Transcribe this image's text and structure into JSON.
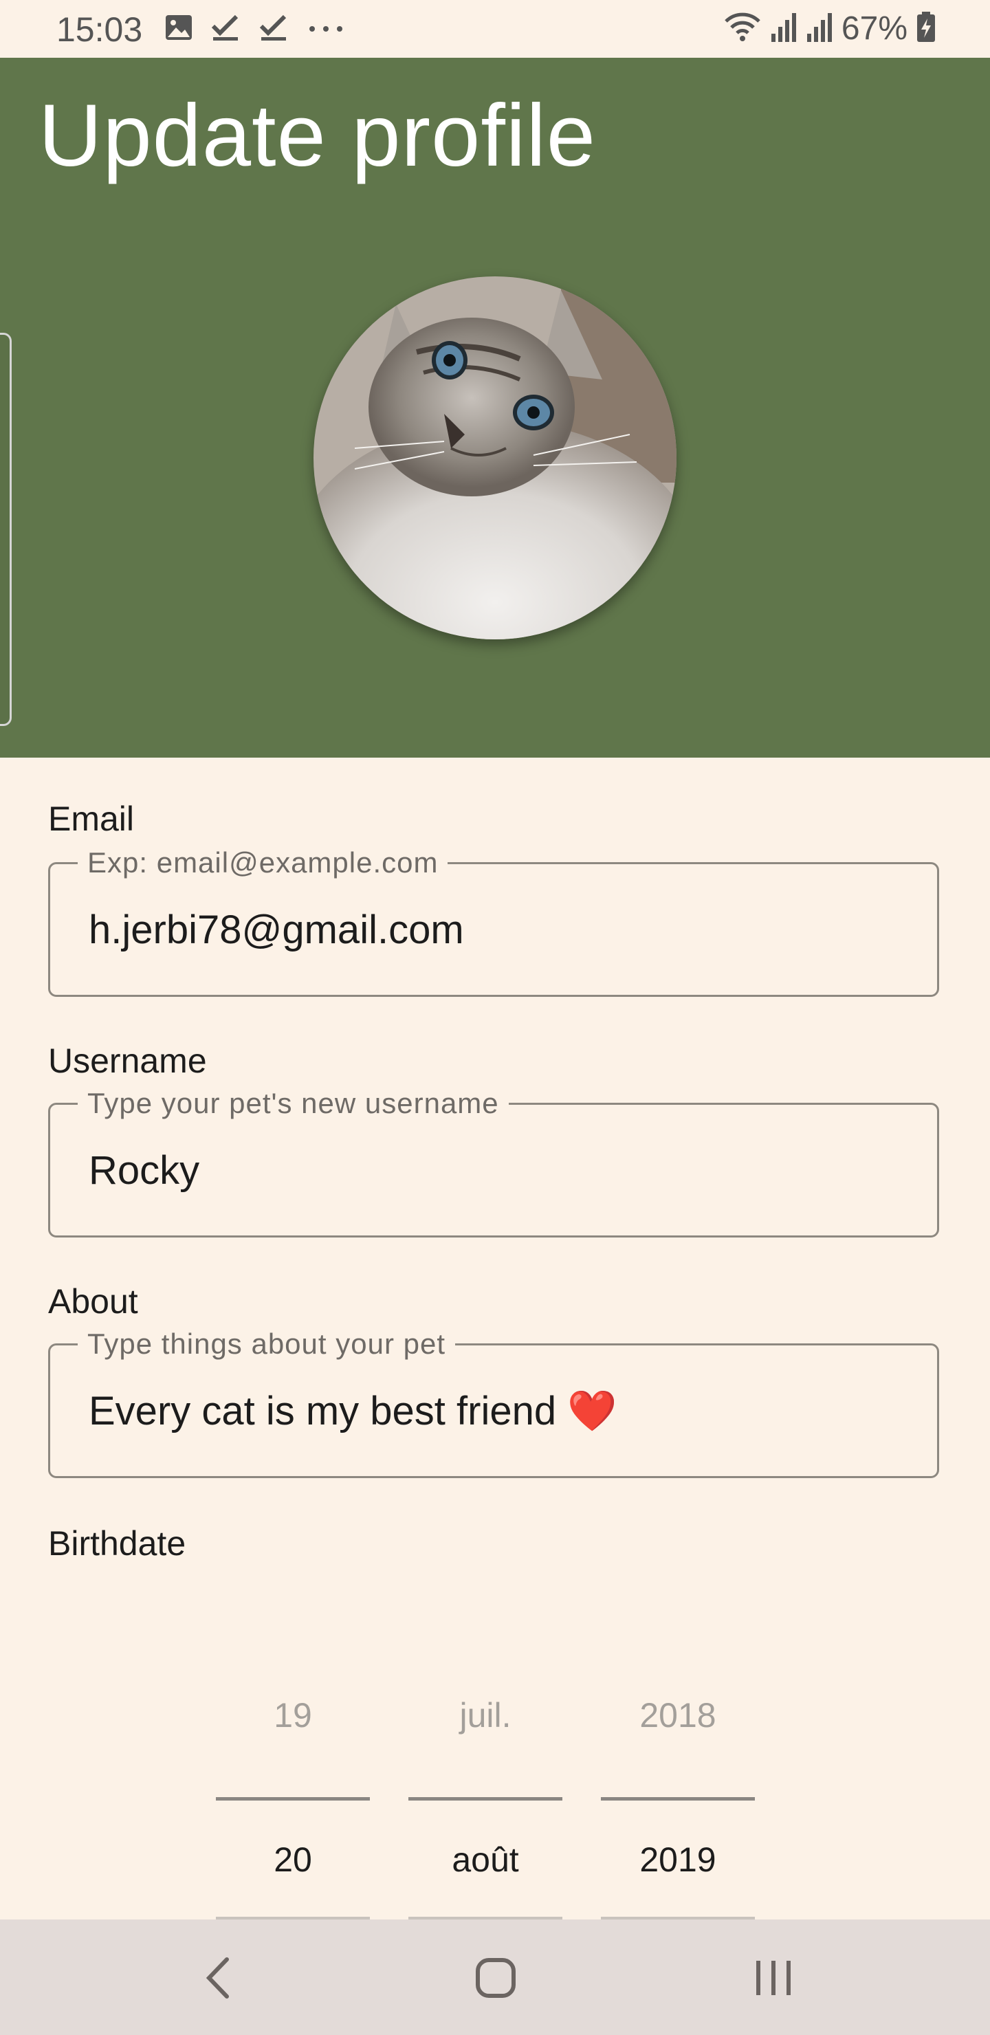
{
  "status_bar": {
    "time": "15:03",
    "battery": "67%",
    "left_icons": [
      "gallery-icon",
      "check-icon",
      "check-icon",
      "more-icon"
    ],
    "right_icons": [
      "wifi-icon",
      "signal-icon",
      "signal-icon",
      "battery-charging-icon"
    ]
  },
  "header": {
    "title": "Update profile",
    "background_color": "#60764b"
  },
  "form": {
    "email": {
      "label": "Email",
      "placeholder": "Exp: email@example.com",
      "value": "h.jerbi78@gmail.com"
    },
    "username": {
      "label": "Username",
      "placeholder": "Type your pet's new username",
      "value": "Rocky"
    },
    "about": {
      "label": "About",
      "placeholder": "Type things about your pet",
      "value": "Every cat is my best friend ❤️"
    },
    "birthdate": {
      "label": "Birthdate",
      "day": {
        "previous": "19",
        "selected": "20"
      },
      "month": {
        "previous": "juil.",
        "selected": "août"
      },
      "year": {
        "previous": "2018",
        "selected": "2019"
      }
    }
  },
  "nav_bar": {
    "buttons": [
      "back-icon",
      "home-icon",
      "recents-icon"
    ]
  },
  "colors": {
    "page_background": "#fcf2e7",
    "header": "#60764b",
    "nav_bar": "#e3dbd8"
  }
}
